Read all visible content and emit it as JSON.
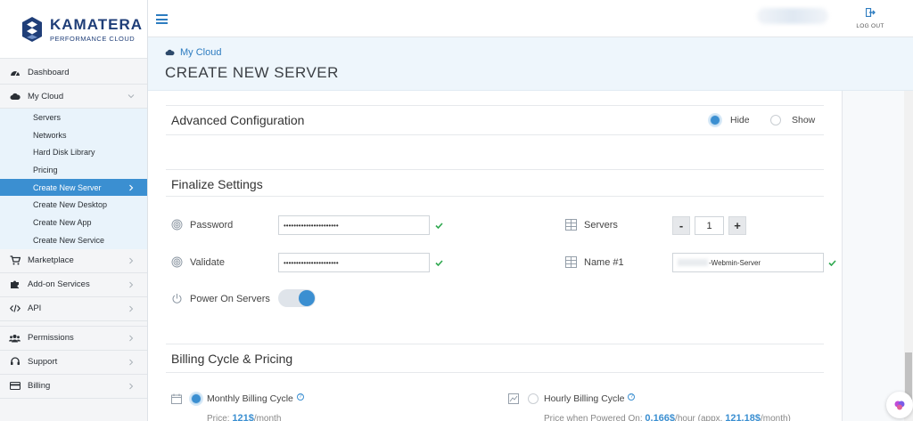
{
  "brand": {
    "name": "KAMATERA",
    "tagline": "PERFORMANCE CLOUD"
  },
  "topbar": {
    "logout_label": "LOG OUT"
  },
  "sidebar": {
    "items": [
      {
        "label": "Dashboard",
        "icon": "dashboard-icon"
      },
      {
        "label": "My Cloud",
        "icon": "cloud-icon"
      },
      {
        "label": "Marketplace",
        "icon": "cart-icon"
      },
      {
        "label": "Add-on Services",
        "icon": "puzzle-icon"
      },
      {
        "label": "API",
        "icon": "code-icon"
      },
      {
        "label": "Permissions",
        "icon": "users-icon"
      },
      {
        "label": "Support",
        "icon": "headset-icon"
      },
      {
        "label": "Billing",
        "icon": "card-icon"
      }
    ],
    "sub_items": [
      "Servers",
      "Networks",
      "Hard Disk Library",
      "Pricing",
      "Create New Server",
      "Create New Desktop",
      "Create New App",
      "Create New Service"
    ],
    "active_sub": "Create New Server"
  },
  "header": {
    "breadcrumb": "My Cloud",
    "title": "CREATE NEW SERVER"
  },
  "advanced": {
    "title": "Advanced Configuration",
    "hide_label": "Hide",
    "show_label": "Show",
    "selected": "Hide"
  },
  "finalize": {
    "title": "Finalize Settings",
    "password_label": "Password",
    "password_value": "••••••••••••••••••••••",
    "validate_label": "Validate",
    "validate_value": "••••••••••••••••••••••",
    "power_label": "Power On Servers",
    "power_on": true,
    "servers_label": "Servers",
    "servers_count": "1",
    "minus": "-",
    "plus": "+",
    "name_label": "Name #1",
    "name_suffix": "-Webmin-Server"
  },
  "billing": {
    "title": "Billing Cycle & Pricing",
    "monthly_label": "Monthly Billing Cycle",
    "monthly_price_prefix": "Price: ",
    "monthly_price": "121$",
    "monthly_price_unit": "/month",
    "hourly_label": "Hourly Billing Cycle",
    "hourly_price_prefix": "Price when Powered On: ",
    "hourly_price": "0.166$",
    "hourly_mid": "/hour (appx. ",
    "hourly_month_price": "121.18$",
    "hourly_suffix": "/month)",
    "selected": "Monthly"
  },
  "colors": {
    "accent": "#3b8fd1",
    "brand": "#1f3e78",
    "check": "#2fa84f"
  }
}
